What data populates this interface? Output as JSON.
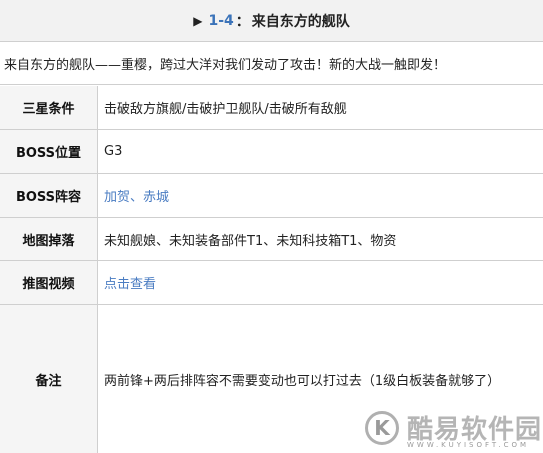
{
  "title": {
    "arrow": "▶",
    "number": "1-4",
    "separator": "：",
    "name": "来自东方的舰队"
  },
  "description": "来自东方的舰队——重樱，跨过大洋对我们发动了攻击！新的大战一触即发！",
  "rows": {
    "stars": {
      "label": "三星条件",
      "value": "击破敌方旗舰/击破护卫舰队/击破所有敌舰"
    },
    "boss_position": {
      "label": "BOSS位置",
      "value": "G3"
    },
    "boss_lineup": {
      "label": "BOSS阵容",
      "items": [
        "加贺",
        "赤城"
      ],
      "separator": "、"
    },
    "drops": {
      "label": "地图掉落",
      "value": "未知舰娘、未知装备部件T1、未知科技箱T1、物资"
    },
    "video": {
      "label": "推图视频",
      "value": "点击查看"
    },
    "notes": {
      "label": "备注",
      "value": "两前锋+两后排阵容不需要变动也可以打过去（1级白板装备就够了）"
    }
  },
  "watermark": {
    "logo_letter": "K",
    "text": "酷易软件园",
    "url": "WWW.KUYISOFT.COM"
  },
  "colors": {
    "link": "#4a7cc2",
    "label_bg": "#f5f5f5",
    "border": "#cfcfcf"
  }
}
